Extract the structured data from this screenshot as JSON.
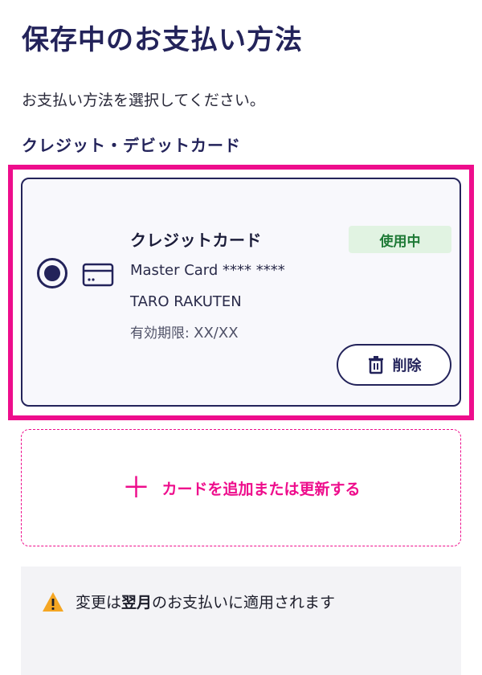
{
  "header": {
    "title": "保存中のお支払い方法"
  },
  "instruction": "お支払い方法を選択してください。",
  "section": {
    "heading": "クレジット・デビットカード"
  },
  "card": {
    "title": "クレジットカード",
    "number": "Master Card **** ****",
    "holder": "TARO RAKUTEN",
    "expiry_label": "有効期限:",
    "expiry_value": "XX/XX",
    "status": "使用中",
    "delete_label": "削除",
    "selected": true
  },
  "add_card": {
    "label": "カードを追加または更新する"
  },
  "notice": {
    "prefix": "変更は",
    "emphasis": "翌月",
    "suffix": "のお支払いに適用されます"
  },
  "colors": {
    "brand": "#23235a",
    "accent": "#ee0d8c",
    "success_bg": "#e1f3e2",
    "success_text": "#1e7a36",
    "warning": "#f5a623"
  },
  "icons": {
    "card": "credit-card-icon",
    "delete": "trash-icon",
    "add": "plus-icon",
    "notice": "warning-icon"
  }
}
